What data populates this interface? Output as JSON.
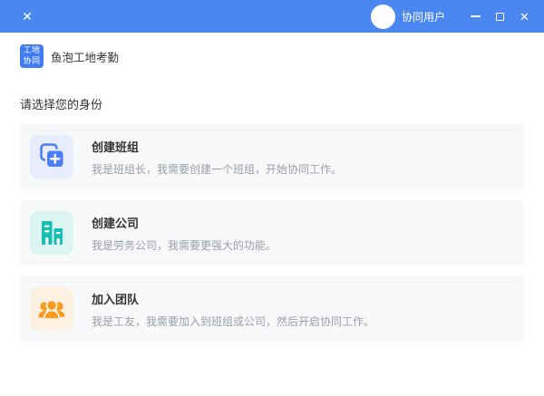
{
  "window": {
    "left_close_glyph": "✕",
    "user_name": "协同用户",
    "close_glyph": "✕",
    "titlebar_color": "#4a87f0"
  },
  "brand": {
    "logo_line1": "工地",
    "logo_line2": "协同",
    "app_name": "鱼泡工地考勤"
  },
  "main": {
    "heading": "请选择您的身份",
    "cards": [
      {
        "title": "创建班组",
        "desc": "我是班组长，我需要创建一个班组，开始协同工作。",
        "icon": "duplicate-plus-icon",
        "accent": "#4c7ef5",
        "icon_bg": "#e7edfc"
      },
      {
        "title": "创建公司",
        "desc": "我是劳务公司，我需要更强大的功能。",
        "icon": "company-buildings-icon",
        "accent": "#16bfb2",
        "icon_bg": "#dcf5f2"
      },
      {
        "title": "加入团队",
        "desc": "我是工友，我需要加入到班组或公司，然后开启协同工作。",
        "icon": "people-group-icon",
        "accent": "#f79a1e",
        "icon_bg": "#fcf1e1"
      }
    ]
  }
}
